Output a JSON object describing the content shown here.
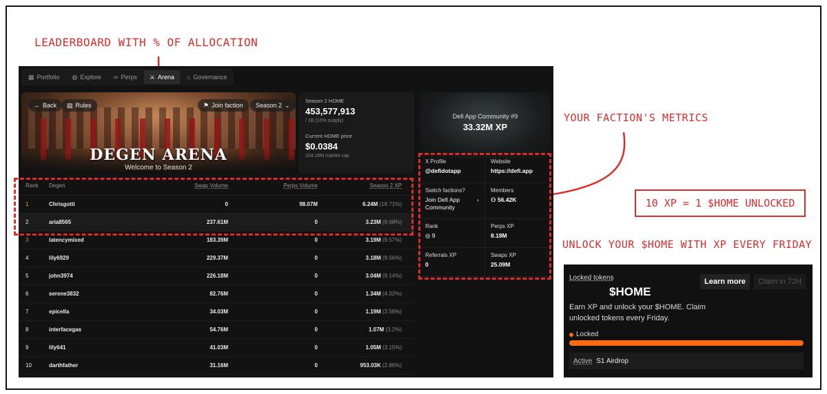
{
  "annotations": {
    "leaderboard": "LEADERBOARD WITH % OF ALLOCATION",
    "faction": "YOUR FACTION'S METRICS",
    "ratio": "10 XP = 1 $HOME UNLOCKED",
    "unlock": "UNLOCK YOUR $HOME WITH XP EVERY FRIDAY"
  },
  "nav": [
    {
      "label": "Portfolio",
      "icon": "grid-icon"
    },
    {
      "label": "Explore",
      "icon": "globe-icon"
    },
    {
      "label": "Perps",
      "icon": "infinity-icon"
    },
    {
      "label": "Arena",
      "icon": "swords-icon",
      "active": true
    },
    {
      "label": "Governance",
      "icon": "bank-icon"
    }
  ],
  "hero": {
    "back": "Back",
    "rules": "Rules",
    "join": "Join faction",
    "season": "Season 2",
    "title": "DEGEN ARENA",
    "subtitle": "Welcome to Season 2"
  },
  "stats": {
    "home_label": "Season 2 HOME",
    "home_value": "453,577,913",
    "home_sub": "/ 1B (10% supply)",
    "price_label": "Current HOME price",
    "price_value": "$0.0384",
    "price_sub": "104.16M market cap"
  },
  "table": {
    "headers": {
      "rank": "Rank",
      "degen": "Degen",
      "swap": "Swap Volume",
      "perps": "Perps Volume",
      "xp": "Season 2 XP"
    },
    "rows": [
      {
        "rank": "1",
        "degen": "Chrisgotti",
        "swap": "0",
        "perps": "98.07M",
        "xp": "6.24M",
        "pct": "(18.71%)"
      },
      {
        "rank": "2",
        "degen": "aria8565",
        "swap": "237.61M",
        "perps": "0",
        "xp": "3.23M",
        "pct": "(9.68%)"
      },
      {
        "rank": "3",
        "degen": "latencymixed",
        "swap": "183.39M",
        "perps": "0",
        "xp": "3.19M",
        "pct": "(9.57%)"
      },
      {
        "rank": "4",
        "degen": "lily6929",
        "swap": "229.37M",
        "perps": "0",
        "xp": "3.18M",
        "pct": "(9.56%)"
      },
      {
        "rank": "5",
        "degen": "john3974",
        "swap": "226.18M",
        "perps": "0",
        "xp": "3.04M",
        "pct": "(9.14%)"
      },
      {
        "rank": "6",
        "degen": "serene3832",
        "swap": "82.76M",
        "perps": "0",
        "xp": "1.34M",
        "pct": "(4.02%)"
      },
      {
        "rank": "7",
        "degen": "epicella",
        "swap": "34.03M",
        "perps": "0",
        "xp": "1.19M",
        "pct": "(3.56%)"
      },
      {
        "rank": "8",
        "degen": "interfacegas",
        "swap": "54.76M",
        "perps": "0",
        "xp": "1.07M",
        "pct": "(3.2%)"
      },
      {
        "rank": "9",
        "degen": "lily641",
        "swap": "41.03M",
        "perps": "0",
        "xp": "1.05M",
        "pct": "(3.15%)"
      },
      {
        "rank": "10",
        "degen": "darthfather",
        "swap": "31.16M",
        "perps": "0",
        "xp": "953.03K",
        "pct": "(2.86%)"
      }
    ]
  },
  "faction": {
    "name": "Defi App Community",
    "rank_tag": "#9",
    "xp": "33.32M XP",
    "x_profile_label": "X Profile",
    "x_profile": "@defidotapp",
    "website_label": "Website",
    "website": "https://defi.app",
    "switch_label": "Switch factions?",
    "switch_value": "Join Defi App Community",
    "members_label": "Members",
    "members": "56.42K",
    "rank_label": "Rank",
    "rank": "9",
    "perps_label": "Perps XP",
    "perps": "8.18M",
    "referrals_label": "Referrals XP",
    "referrals": "0",
    "swaps_label": "Swaps XP",
    "swaps": "25.09M"
  },
  "locked": {
    "label": "Locked tokens",
    "title": "$HOME",
    "learn": "Learn more",
    "claim": "Claim in 72H",
    "desc": "Earn XP and unlock your $HOME. Claim unlocked tokens every Friday.",
    "locked_label": "Locked",
    "locked_fraction": 1.0,
    "active": "Active",
    "airdrop": "S1 Airdrop"
  },
  "colors": {
    "accent": "#e02b2b",
    "orange": "#ff6a13",
    "gold": "#f2b134"
  }
}
